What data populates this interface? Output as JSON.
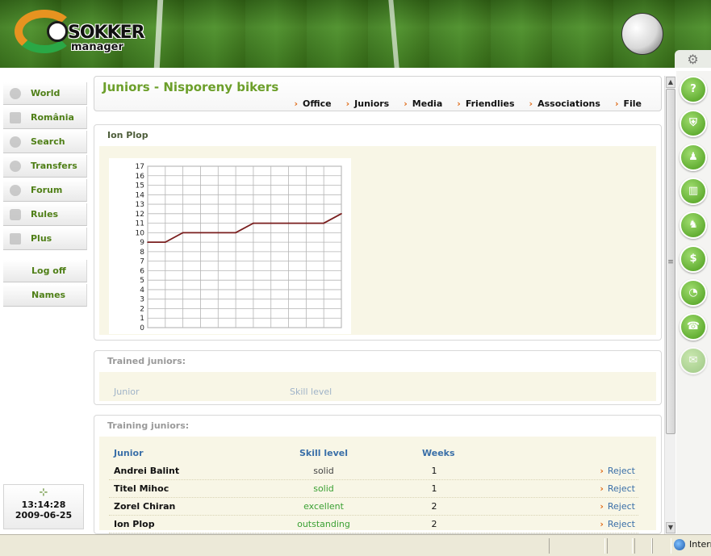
{
  "header": {
    "logo_text": "SOKKER",
    "logo_sub": "manager",
    "gear_icon": "gear-icon"
  },
  "leftnav": {
    "items": [
      {
        "label": "World",
        "icon": "globe-icon"
      },
      {
        "label": "România",
        "icon": "flag-icon"
      },
      {
        "label": "Search",
        "icon": "magnifier-icon"
      },
      {
        "label": "Transfers",
        "icon": "arrows-icon"
      },
      {
        "label": "Forum",
        "icon": "people-icon"
      },
      {
        "label": "Rules",
        "icon": "hand-icon"
      },
      {
        "label": "Plus",
        "icon": "star-icon"
      }
    ],
    "logoff_label": "Log off",
    "names_label": "Names"
  },
  "clock": {
    "time": "13:14:28",
    "date": "2009-06-25"
  },
  "page": {
    "title": "Juniors - Nisporeny bikers",
    "topnav": [
      "Office",
      "Juniors",
      "Media",
      "Friendlies",
      "Associations",
      "File"
    ]
  },
  "player_panel": {
    "title": "Ion Plop"
  },
  "chart_data": {
    "type": "line",
    "title": "",
    "xlabel": "",
    "ylabel": "",
    "ylim": [
      0,
      17
    ],
    "yticks": [
      0,
      1,
      2,
      3,
      4,
      5,
      6,
      7,
      8,
      9,
      10,
      11,
      12,
      13,
      14,
      15,
      16,
      17
    ],
    "grid": true,
    "x": [
      0,
      1,
      2,
      3,
      4,
      5,
      6,
      7,
      8,
      9,
      10,
      11
    ],
    "series": [
      {
        "color": "#7a1f1f",
        "values": [
          9,
          9,
          10,
          10,
          10,
          10,
          11,
          11,
          11,
          11,
          11,
          12
        ]
      }
    ]
  },
  "trained": {
    "title": "Trained juniors:",
    "col_junior": "Junior",
    "col_skill": "Skill level"
  },
  "training": {
    "title": "Training juniors:",
    "headers": {
      "junior": "Junior",
      "skill": "Skill level",
      "weeks": "Weeks"
    },
    "reject_label": "Reject",
    "rows": [
      {
        "name": "Andrei Balint",
        "skill": "solid",
        "weeks": "1",
        "skill_color": "#444444"
      },
      {
        "name": "Titel Mihoc",
        "skill": "solid",
        "weeks": "1",
        "skill_color": "#3aa033"
      },
      {
        "name": "Zorel Chiran",
        "skill": "excellent",
        "weeks": "2",
        "skill_color": "#3aa033"
      },
      {
        "name": "Ion Plop",
        "skill": "outstanding",
        "weeks": "2",
        "skill_color": "#3aa033"
      }
    ]
  },
  "rightbar": {
    "icons": [
      "help-icon",
      "shield-icon",
      "player-icon",
      "tactics-icon",
      "training-icon",
      "money-icon",
      "finance-icon",
      "phone-icon",
      "mail-icon"
    ]
  },
  "statusbar": {
    "zone_text": "Intern"
  },
  "colors": {
    "brand_green": "#6c9f2a",
    "link_blue": "#3a6fa8",
    "accent_orange": "#e06d1b",
    "panel_bg": "#f8f6e6"
  }
}
